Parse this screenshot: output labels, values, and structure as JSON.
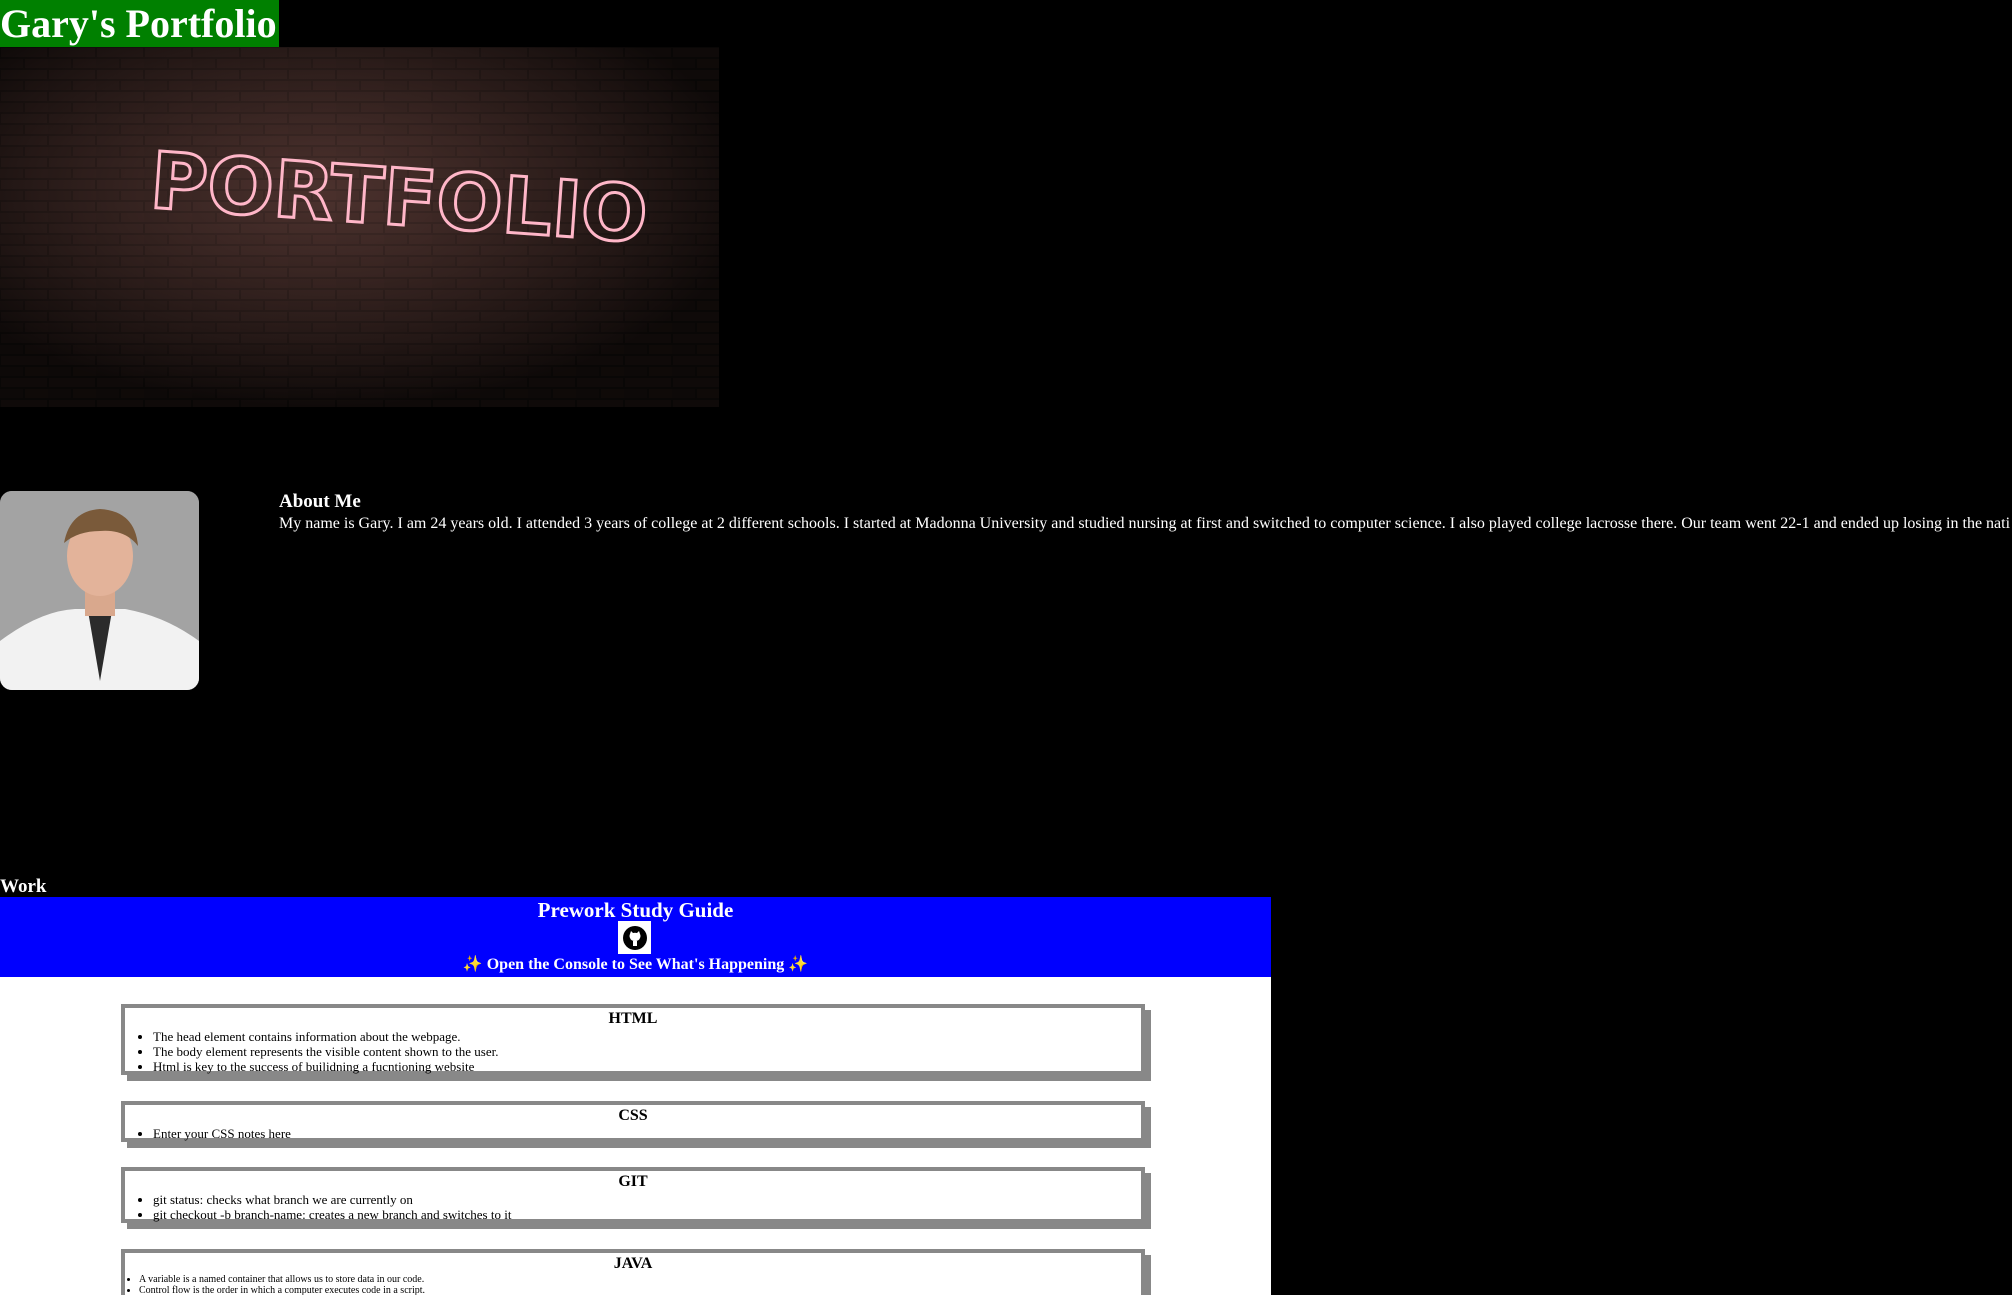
{
  "header": {
    "title": "Gary's Portfolio"
  },
  "hero": {
    "sign_text": "PORTFOLIO"
  },
  "about": {
    "heading": "About Me",
    "text": "My name is Gary. I am 24 years old. I attended 3 years of college at 2 different schools. I started at Madonna University and studied nursing at first and switched to computer science. I also played college lacrosse there. Our team went 22-1 and ended up losing in the nati"
  },
  "work": {
    "heading": "Work"
  },
  "study_guide": {
    "title": "Prework Study Guide",
    "subtitle": "Open the Console to See What's Happening",
    "sparkle": "✨",
    "logo_icon": "github-icon",
    "sections": [
      {
        "title": "HTML",
        "items": [
          "The head element contains information about the webpage.",
          "The body element represents the visible content shown to the user.",
          "Html is key to the success of builidning a fucntioning website"
        ]
      },
      {
        "title": "CSS",
        "items": [
          "Enter your CSS notes here"
        ]
      },
      {
        "title": "GIT",
        "items": [
          "git status: checks what branch we are currently on",
          "git checkout -b branch-name: creates a new branch and switches to it"
        ]
      },
      {
        "title": "JAVA",
        "items": [
          "A variable is a named container that allows us to store data in our code.",
          "Control flow is the order in which a computer executes code in a script."
        ]
      }
    ]
  },
  "colors": {
    "header_bg": "#008000",
    "guide_header_bg": "#0000ff",
    "page_bg": "#000000",
    "card_border": "#888888"
  }
}
